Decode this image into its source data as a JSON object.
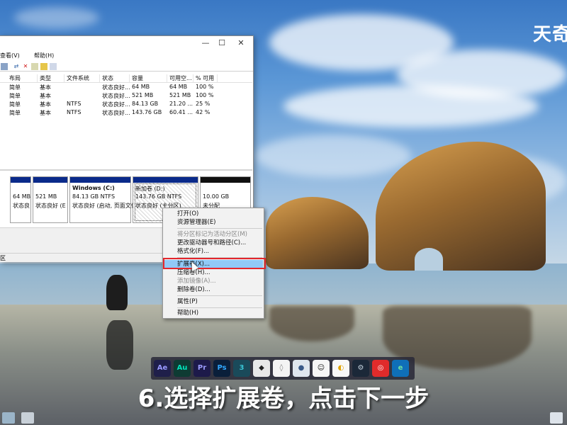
{
  "brand": {
    "logo_text": "天奇"
  },
  "window": {
    "menu": [
      "查看(V)",
      "帮助(H)"
    ],
    "controls": {
      "minimize": "—",
      "maximize": "☐",
      "close": "✕"
    },
    "columns": [
      "布局",
      "类型",
      "文件系统",
      "状态",
      "容量",
      "可用空...",
      "% 可用"
    ],
    "rows": [
      [
        "简单",
        "基本",
        "",
        "状态良好...",
        "64 MB",
        "64 MB",
        "100 %"
      ],
      [
        "简单",
        "基本",
        "",
        "状态良好...",
        "521 MB",
        "521 MB",
        "100 %"
      ],
      [
        "简单",
        "基本",
        "NTFS",
        "状态良好...",
        "84.13 GB",
        "21.20 ...",
        "25 %"
      ],
      [
        "简单",
        "基本",
        "NTFS",
        "状态良好...",
        "143.76 GB",
        "60.41 ...",
        "42 %"
      ]
    ],
    "partitions": [
      {
        "size": "64 MB",
        "status": "状态良"
      },
      {
        "size": "521 MB",
        "status": "状态良好 (E"
      },
      {
        "name": "Windows  (C:)",
        "size": "84.13 GB NTFS",
        "status": "状态良好 (启动, 页面文件"
      },
      {
        "name": "新加卷  (D:)",
        "size": "143.76 GB NTFS",
        "status": "状态良好 (主分区)"
      },
      {
        "size": "10.00 GB",
        "status": "未分配"
      }
    ],
    "status_text": "区"
  },
  "context_menu": {
    "items": [
      {
        "label": "打开(O)",
        "disabled": false
      },
      {
        "label": "资源管理器(E)",
        "disabled": false
      },
      {
        "label": "将分区标记为活动分区(M)",
        "disabled": true
      },
      {
        "label": "更改驱动器号和路径(C)...",
        "disabled": false
      },
      {
        "label": "格式化(F)...",
        "disabled": false
      },
      {
        "label": "扩展卷(X)...",
        "disabled": false,
        "highlighted": true
      },
      {
        "label": "压缩卷(H)...",
        "disabled": false
      },
      {
        "label": "添加镜像(A)...",
        "disabled": true
      },
      {
        "label": "删除卷(D)...",
        "disabled": false
      },
      {
        "label": "属性(P)",
        "disabled": false
      },
      {
        "label": "帮助(H)",
        "disabled": false
      }
    ]
  },
  "dock": {
    "apps": [
      {
        "icon": "after-effects-icon",
        "label": "Ae",
        "color": "#1f1f4a",
        "fg": "#9999ff"
      },
      {
        "icon": "audition-icon",
        "label": "Au",
        "color": "#0e3b33",
        "fg": "#00e4bb"
      },
      {
        "icon": "premiere-icon",
        "label": "Pr",
        "color": "#1d1a4a",
        "fg": "#9d9dff"
      },
      {
        "icon": "photoshop-icon",
        "label": "Ps",
        "color": "#0a1f3a",
        "fg": "#31a8ff"
      },
      {
        "icon": "3dsmax-icon",
        "label": "3",
        "color": "#1a4a5a",
        "fg": "#39c6d6"
      },
      {
        "icon": "unity-icon",
        "label": "◆",
        "color": "#e8e8e8",
        "fg": "#222222"
      },
      {
        "icon": "droplet-icon",
        "label": "◊",
        "color": "#f4f4f4",
        "fg": "#888888"
      },
      {
        "icon": "media-icon",
        "label": "●",
        "color": "#dfe6ee",
        "fg": "#3a5a88"
      },
      {
        "icon": "qq-icon",
        "label": "☺",
        "color": "#f6f6f6",
        "fg": "#111111"
      },
      {
        "icon": "coin-icon",
        "label": "◐",
        "color": "#f8f8f8",
        "fg": "#e0a300"
      },
      {
        "icon": "steam-icon",
        "label": "⚙",
        "color": "#1b2838",
        "fg": "#c7d5e0"
      },
      {
        "icon": "netease-music-icon",
        "label": "◎",
        "color": "#e02b2b",
        "fg": "#ffffff"
      },
      {
        "icon": "edge-icon",
        "label": "e",
        "color": "#0f6fb8",
        "fg": "#6fe0a0"
      }
    ]
  },
  "caption": "6.选择扩展卷，点击下一步"
}
